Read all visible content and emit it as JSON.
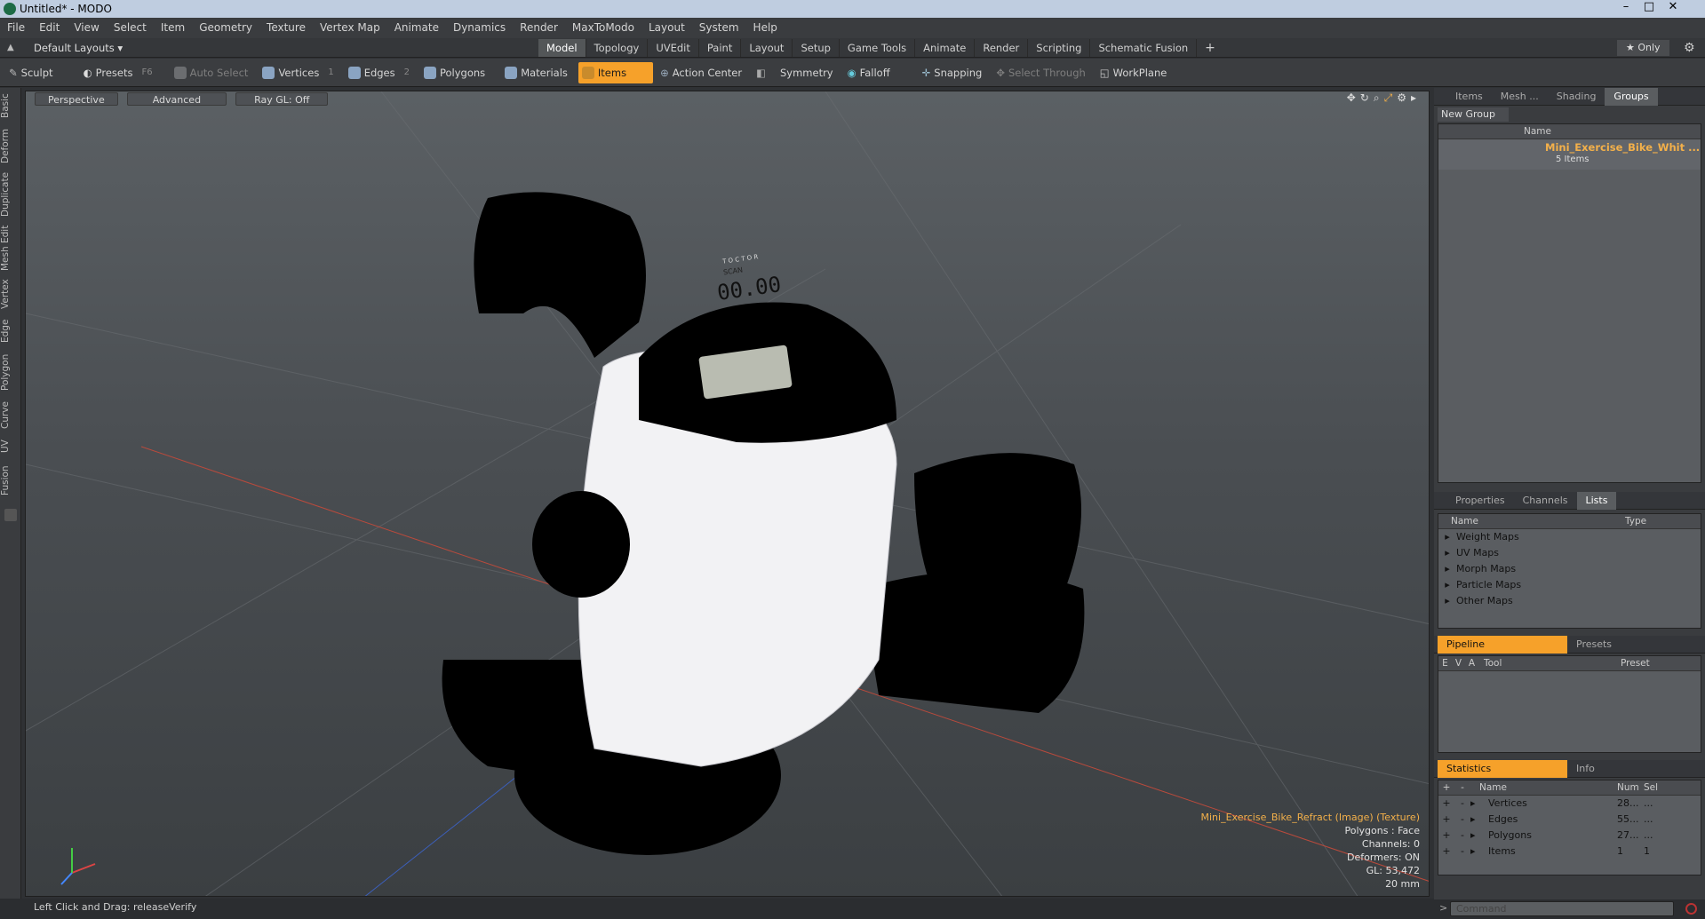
{
  "window": {
    "title": "Untitled* - MODO",
    "min": "–",
    "max": "□",
    "close": "✕"
  },
  "menu": [
    "File",
    "Edit",
    "View",
    "Select",
    "Item",
    "Geometry",
    "Texture",
    "Vertex Map",
    "Animate",
    "Dynamics",
    "Render",
    "MaxToModo",
    "Layout",
    "System",
    "Help"
  ],
  "layouts": {
    "default": "Default Layouts ▾",
    "tabs": [
      "Model",
      "Topology",
      "UVEdit",
      "Paint",
      "Layout",
      "Setup",
      "Game Tools",
      "Animate",
      "Render",
      "Scripting",
      "Schematic Fusion"
    ],
    "plus": "+",
    "only": "★ Only",
    "gear": "⚙"
  },
  "toolbar": {
    "sculpt": "Sculpt",
    "presets": "Presets",
    "presets_key": "F6",
    "auto_select": "Auto Select",
    "vertices": "Vertices",
    "vertices_key": "1",
    "edges": "Edges",
    "edges_key": "2",
    "polygons": "Polygons",
    "materials": "Materials",
    "items": "Items",
    "action_center": "Action Center",
    "symmetry": "Symmetry",
    "falloff": "Falloff",
    "snapping": "Snapping",
    "select_through": "Select Through",
    "workplane": "WorkPlane"
  },
  "left_tabs": [
    "Basic",
    "Deform",
    "Duplicate",
    "Mesh Edit",
    "Vertex",
    "Edge",
    "Polygon",
    "Curve",
    "UV",
    "Fusion"
  ],
  "viewport": {
    "perspective": "Perspective",
    "advanced": "Advanced",
    "raygl": "Ray GL: Off",
    "lcd_brand": "T O C T O R",
    "lcd_digits": "00.00",
    "lcd_scan": "SCAN",
    "info": {
      "texture": "Mini_Exercise_Bike_Refract (Image) (Texture)",
      "polygons": "Polygons : Face",
      "channels": "Channels: 0",
      "deformers": "Deformers: ON",
      "gl": "GL: 53,472",
      "scale": "20 mm"
    }
  },
  "groups_panel": {
    "tabs": [
      "Items",
      "Mesh ...",
      "Shading",
      "Groups"
    ],
    "new_group": "New Group",
    "name_col": "Name",
    "group_name": "Mini_Exercise_Bike_Whit ...",
    "group_count": "5 Items"
  },
  "lists_panel": {
    "tabs": [
      "Properties",
      "Channels",
      "Lists"
    ],
    "name_col": "Name",
    "type_col": "Type",
    "items": [
      "Weight Maps",
      "UV Maps",
      "Morph Maps",
      "Particle Maps",
      "Other Maps"
    ]
  },
  "pipeline_panel": {
    "tabs": [
      "Pipeline",
      "Presets"
    ],
    "cols": [
      "E",
      "V",
      "A",
      "Tool",
      "Preset"
    ]
  },
  "stats_panel": {
    "tabs": [
      "Statistics",
      "Info"
    ],
    "cols": [
      "+",
      "-",
      "Name",
      "Num",
      "Sel"
    ],
    "rows": [
      {
        "name": "Vertices",
        "num": "28...",
        "sel": "..."
      },
      {
        "name": "Edges",
        "num": "55...",
        "sel": "..."
      },
      {
        "name": "Polygons",
        "num": "27...",
        "sel": "..."
      },
      {
        "name": "Items",
        "num": "1",
        "sel": "1"
      }
    ]
  },
  "status": {
    "text": "Left Click and Drag:  releaseVerify"
  },
  "command": {
    "placeholder": "Command"
  }
}
